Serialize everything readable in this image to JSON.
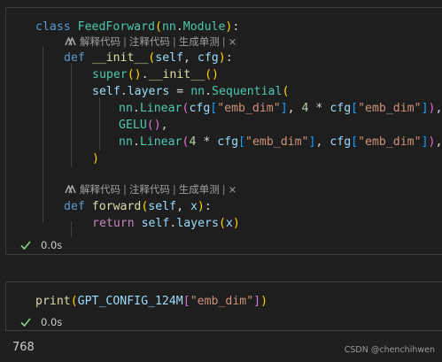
{
  "cells": [
    {
      "lines": [
        [
          {
            "t": "class ",
            "c": "kw"
          },
          {
            "t": "FeedForward",
            "c": "cls"
          },
          {
            "t": "(",
            "c": "p1"
          },
          {
            "t": "nn",
            "c": "cls"
          },
          {
            "t": ".",
            "c": "op"
          },
          {
            "t": "Module",
            "c": "cls"
          },
          {
            "t": ")",
            "c": "p1"
          },
          {
            "t": ":",
            "c": "op"
          }
        ],
        [
          {
            "t": "def ",
            "c": "kw"
          },
          {
            "t": "__init__",
            "c": "fn"
          },
          {
            "t": "(",
            "c": "p1"
          },
          {
            "t": "self",
            "c": "pv"
          },
          {
            "t": ", ",
            "c": "op"
          },
          {
            "t": "cfg",
            "c": "pv"
          },
          {
            "t": ")",
            "c": "p1"
          },
          {
            "t": ":",
            "c": "op"
          }
        ],
        [
          {
            "t": "super",
            "c": "cls"
          },
          {
            "t": "()",
            "c": "p1"
          },
          {
            "t": ".",
            "c": "op"
          },
          {
            "t": "__init__",
            "c": "fn"
          },
          {
            "t": "()",
            "c": "p1"
          }
        ],
        [
          {
            "t": "self",
            "c": "pv"
          },
          {
            "t": ".",
            "c": "op"
          },
          {
            "t": "layers",
            "c": "pv"
          },
          {
            "t": " = ",
            "c": "op"
          },
          {
            "t": "nn",
            "c": "cls"
          },
          {
            "t": ".",
            "c": "op"
          },
          {
            "t": "Sequential",
            "c": "cls"
          },
          {
            "t": "(",
            "c": "p1"
          }
        ],
        [
          {
            "t": "nn",
            "c": "cls"
          },
          {
            "t": ".",
            "c": "op"
          },
          {
            "t": "Linear",
            "c": "cls"
          },
          {
            "t": "(",
            "c": "p2"
          },
          {
            "t": "cfg",
            "c": "pv"
          },
          {
            "t": "[",
            "c": "p3"
          },
          {
            "t": "\"emb_dim\"",
            "c": "str"
          },
          {
            "t": "]",
            "c": "p3"
          },
          {
            "t": ", ",
            "c": "op"
          },
          {
            "t": "4",
            "c": "num"
          },
          {
            "t": " * ",
            "c": "op"
          },
          {
            "t": "cfg",
            "c": "pv"
          },
          {
            "t": "[",
            "c": "p3"
          },
          {
            "t": "\"emb_dim\"",
            "c": "str"
          },
          {
            "t": "]",
            "c": "p3"
          },
          {
            "t": ")",
            "c": "p2"
          },
          {
            "t": ",",
            "c": "op"
          }
        ],
        [
          {
            "t": "GELU",
            "c": "cls"
          },
          {
            "t": "()",
            "c": "p2"
          },
          {
            "t": ",",
            "c": "op"
          }
        ],
        [
          {
            "t": "nn",
            "c": "cls"
          },
          {
            "t": ".",
            "c": "op"
          },
          {
            "t": "Linear",
            "c": "cls"
          },
          {
            "t": "(",
            "c": "p2"
          },
          {
            "t": "4",
            "c": "num"
          },
          {
            "t": " * ",
            "c": "op"
          },
          {
            "t": "cfg",
            "c": "pv"
          },
          {
            "t": "[",
            "c": "p3"
          },
          {
            "t": "\"emb_dim\"",
            "c": "str"
          },
          {
            "t": "]",
            "c": "p3"
          },
          {
            "t": ", ",
            "c": "op"
          },
          {
            "t": "cfg",
            "c": "pv"
          },
          {
            "t": "[",
            "c": "p3"
          },
          {
            "t": "\"emb_dim\"",
            "c": "str"
          },
          {
            "t": "]",
            "c": "p3"
          },
          {
            "t": ")",
            "c": "p2"
          },
          {
            "t": ",",
            "c": "op"
          }
        ],
        [
          {
            "t": ")",
            "c": "p1"
          }
        ],
        [],
        [
          {
            "t": "def ",
            "c": "kw"
          },
          {
            "t": "forward",
            "c": "fn"
          },
          {
            "t": "(",
            "c": "p1"
          },
          {
            "t": "self",
            "c": "pv"
          },
          {
            "t": ", ",
            "c": "op"
          },
          {
            "t": "x",
            "c": "pv"
          },
          {
            "t": ")",
            "c": "p1"
          },
          {
            "t": ":",
            "c": "op"
          }
        ],
        [
          {
            "t": "return ",
            "c": "kw2"
          },
          {
            "t": "self",
            "c": "pv"
          },
          {
            "t": ".",
            "c": "op"
          },
          {
            "t": "layers",
            "c": "pv"
          },
          {
            "t": "(",
            "c": "p1"
          },
          {
            "t": "x",
            "c": "pv"
          },
          {
            "t": ")",
            "c": "p1"
          }
        ]
      ],
      "codelens": {
        "explain": "解释代码",
        "comment": "注释代码",
        "test": "生成单测",
        "close": "×",
        "sep": "|"
      },
      "status": {
        "time": "0.0s"
      }
    },
    {
      "lines": [
        [
          {
            "t": "print",
            "c": "fn"
          },
          {
            "t": "(",
            "c": "p1"
          },
          {
            "t": "GPT_CONFIG_124M",
            "c": "pv"
          },
          {
            "t": "[",
            "c": "p2"
          },
          {
            "t": "\"emb_dim\"",
            "c": "str"
          },
          {
            "t": "]",
            "c": "p2"
          },
          {
            "t": ")",
            "c": "p1"
          }
        ]
      ],
      "status": {
        "time": "0.0s"
      }
    }
  ],
  "output": {
    "text": "768"
  },
  "watermark": {
    "text": "CSDN @chenchihwen"
  },
  "icons": {
    "check": "check-icon",
    "lens": "ai-assistant-icon",
    "close": "close-icon"
  },
  "colors": {
    "keyword": "#569cd6",
    "class": "#4ec9b0",
    "function": "#dcdcaa",
    "variable": "#9cdcfe",
    "string": "#ce9178",
    "number": "#b5cea8",
    "check": "#89d185"
  }
}
